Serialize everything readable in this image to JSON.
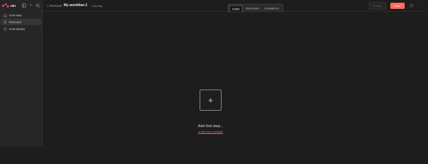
{
  "app": {
    "logo_text": "n8n"
  },
  "sidebar": {
    "items": [
      {
        "label": "Overview",
        "icon": "home-icon",
        "active": false
      },
      {
        "label": "Personal",
        "icon": "user-icon",
        "active": true
      },
      {
        "label": "Chat (Beta)",
        "icon": "chat-icon",
        "active": false
      }
    ]
  },
  "header": {
    "breadcrumb_project": "Personal",
    "breadcrumb_sep": "/",
    "workflow_title": "My workflow 2",
    "add_tag_label": "+ Add tag",
    "tabs": [
      {
        "label": "Editor",
        "active": true
      },
      {
        "label": "Executions",
        "active": false
      },
      {
        "label": "Evaluations",
        "active": false
      }
    ],
    "publish_label": "Publish",
    "save_label": "Save"
  },
  "canvas": {
    "add_first_step_label": "Add first step...",
    "template_link_label": "or start from a template"
  },
  "colors": {
    "accent": "#ff6d5a",
    "brand": "#ea4b71",
    "background": "#1d1d1d",
    "sidebar": "#262626"
  }
}
